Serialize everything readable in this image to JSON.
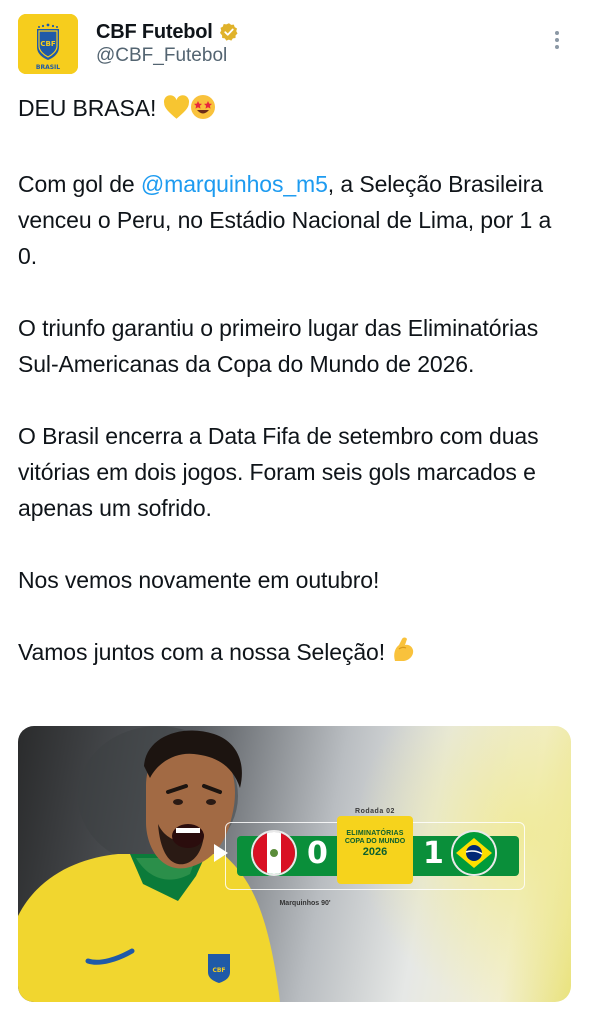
{
  "tweet": {
    "author": {
      "display_name": "CBF Futebol",
      "handle": "@CBF_Futebol",
      "avatar_text": "BRASIL",
      "verified": true,
      "verified_color": "#e0b22a"
    },
    "text": {
      "line1": "DEU BRASA! ",
      "p2_before": "Com gol de ",
      "p2_mention": "@marquinhos_m5",
      "p2_after": ", a Seleção Brasileira venceu o Peru, no Estádio Nacional de Lima, por 1 a 0.",
      "p3": "O triunfo garantiu o primeiro lugar das Eliminatórias Sul-Americanas da Copa do Mundo de 2026.",
      "p4": "O Brasil encerra a Data Fifa de setembro com duas vitórias em dois jogos. Foram seis gols marcados e apenas um sofrido.",
      "p5": "Nos vemos novamente em outubro!",
      "p6": "Vamos juntos com a nossa Seleção! "
    },
    "media": {
      "rodada": "Rodada 02",
      "home_score": "0",
      "away_score": "1",
      "badge_line1": "ELIMINATÓRIAS",
      "badge_line2": "COPA DO MUNDO",
      "badge_line3": "2026",
      "scorer": "Marquinhos 90'"
    },
    "colors": {
      "mention": "#1d9bf0",
      "secondary_text": "#536471",
      "avatar_bg": "#f6cd1d"
    }
  }
}
